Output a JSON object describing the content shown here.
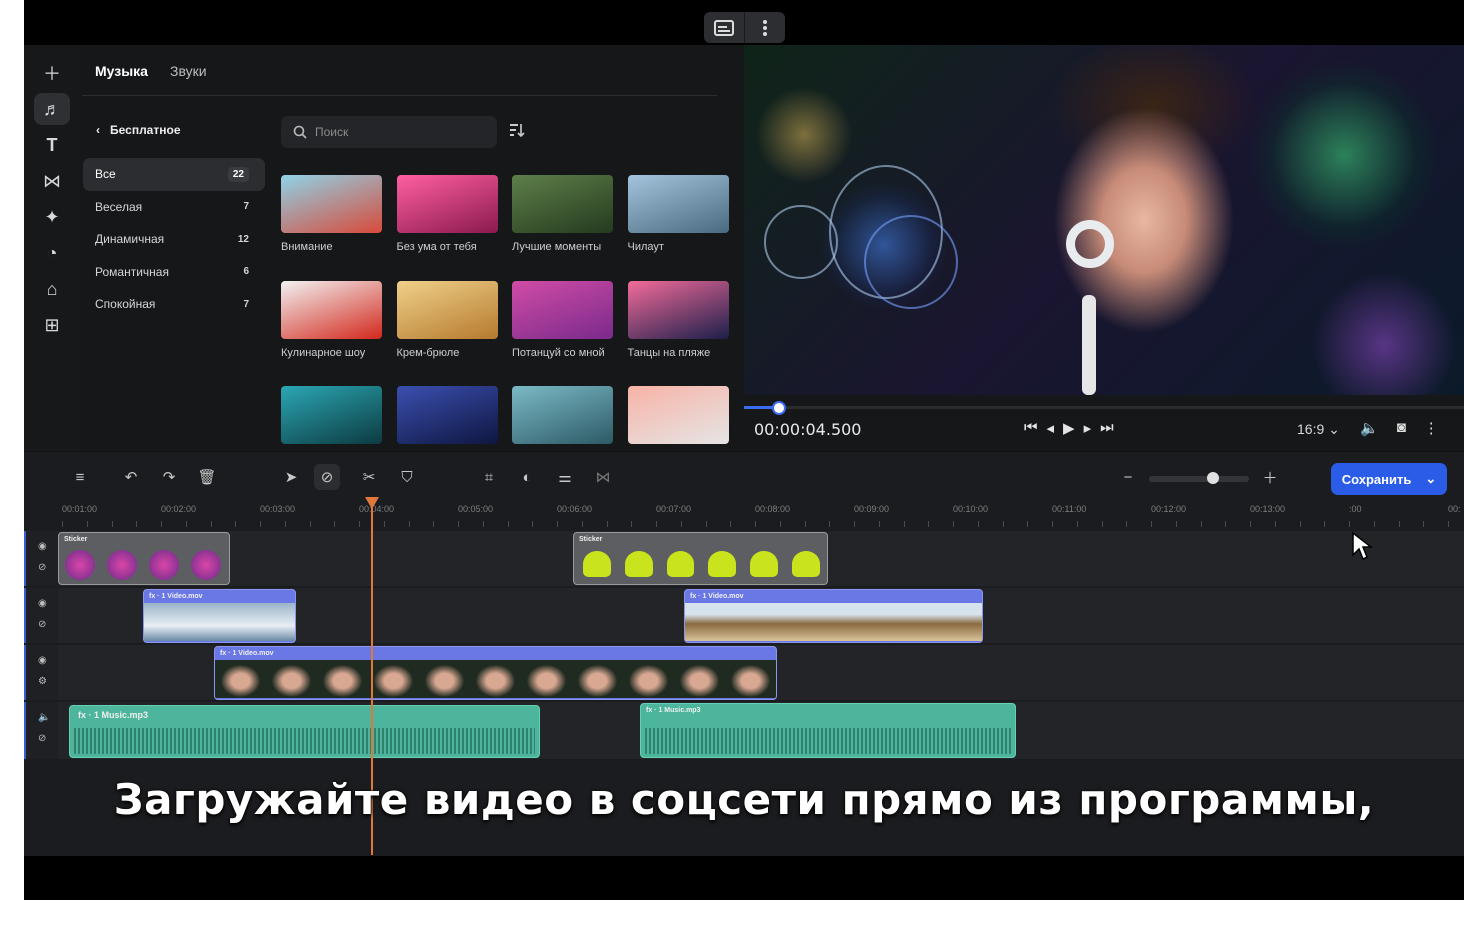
{
  "top_controls": {
    "caption_icon": "subtitles-icon",
    "more_icon": "more-vertical-icon"
  },
  "rail": {
    "items": [
      "plus-icon",
      "music-icon",
      "text-icon",
      "transitions-icon",
      "effects-icon",
      "stickers-icon",
      "media-icon",
      "apps-icon"
    ]
  },
  "library": {
    "tabs": [
      "Музыка",
      "Звуки"
    ],
    "back_label": "Бесплатное",
    "search_placeholder": "Поиск",
    "categories": [
      {
        "label": "Все",
        "count": "22"
      },
      {
        "label": "Веселая",
        "count": "7"
      },
      {
        "label": "Динамичная",
        "count": "12"
      },
      {
        "label": "Романтичная",
        "count": "6"
      },
      {
        "label": "Спокойная",
        "count": "7"
      }
    ],
    "tracks": [
      {
        "label": "Внимание",
        "colors": [
          "#8fd3e8",
          "#d84a3a"
        ]
      },
      {
        "label": "Без ума от тебя",
        "colors": [
          "#ff5fa0",
          "#8a1a4e"
        ]
      },
      {
        "label": "Лучшие моменты",
        "colors": [
          "#5e7f4a",
          "#243a1e"
        ]
      },
      {
        "label": "Чилаут",
        "colors": [
          "#a3c4dc",
          "#4a6a80"
        ]
      },
      {
        "label": "Кулинарное шоу",
        "colors": [
          "#f2f2f2",
          "#d3281c"
        ]
      },
      {
        "label": "Крем-брюле",
        "colors": [
          "#f0d08a",
          "#b57a2e"
        ]
      },
      {
        "label": "Потанцуй со мной",
        "colors": [
          "#d04ca6",
          "#7a2a8c"
        ]
      },
      {
        "label": "Танцы на пляже",
        "colors": [
          "#f36b9a",
          "#1b1f4a"
        ]
      },
      {
        "label": "",
        "colors": [
          "#2aa7b4",
          "#0d3a40"
        ]
      },
      {
        "label": "",
        "colors": [
          "#3b4fb0",
          "#0e1640"
        ]
      },
      {
        "label": "",
        "colors": [
          "#7bbac6",
          "#2c5a66"
        ]
      },
      {
        "label": "",
        "colors": [
          "#f8b3a6",
          "#e5e5e5"
        ]
      }
    ]
  },
  "preview": {
    "timecode": "00:00:04.500",
    "progress": 0.047,
    "aspect": "16:9",
    "controls": [
      "skip-start-icon",
      "frame-back-icon",
      "play-icon",
      "frame-forward-icon",
      "skip-end-icon"
    ]
  },
  "toolbar": {
    "save_label": "Сохранить",
    "zoom_level": 0.64
  },
  "ruler": [
    "00:01:00",
    "00:02:00",
    "00:03:00",
    "00:04:00",
    "00:05:00",
    "00:06:00",
    "00:07:00",
    "00:08:00",
    "00:09:00",
    "00:10:00",
    "00:11:00",
    "00:12:00",
    "00:13:00",
    ":00",
    "00:"
  ],
  "tracks": {
    "sticker_label": "Sticker",
    "video_label": "fx · 1  Video.mov",
    "audio_label_a": "fx · 1  Music.mp3",
    "audio_label_b": "fx · 1  Music.mp3"
  },
  "caption": "Загружайте видео в соцсети прямо из программы,"
}
